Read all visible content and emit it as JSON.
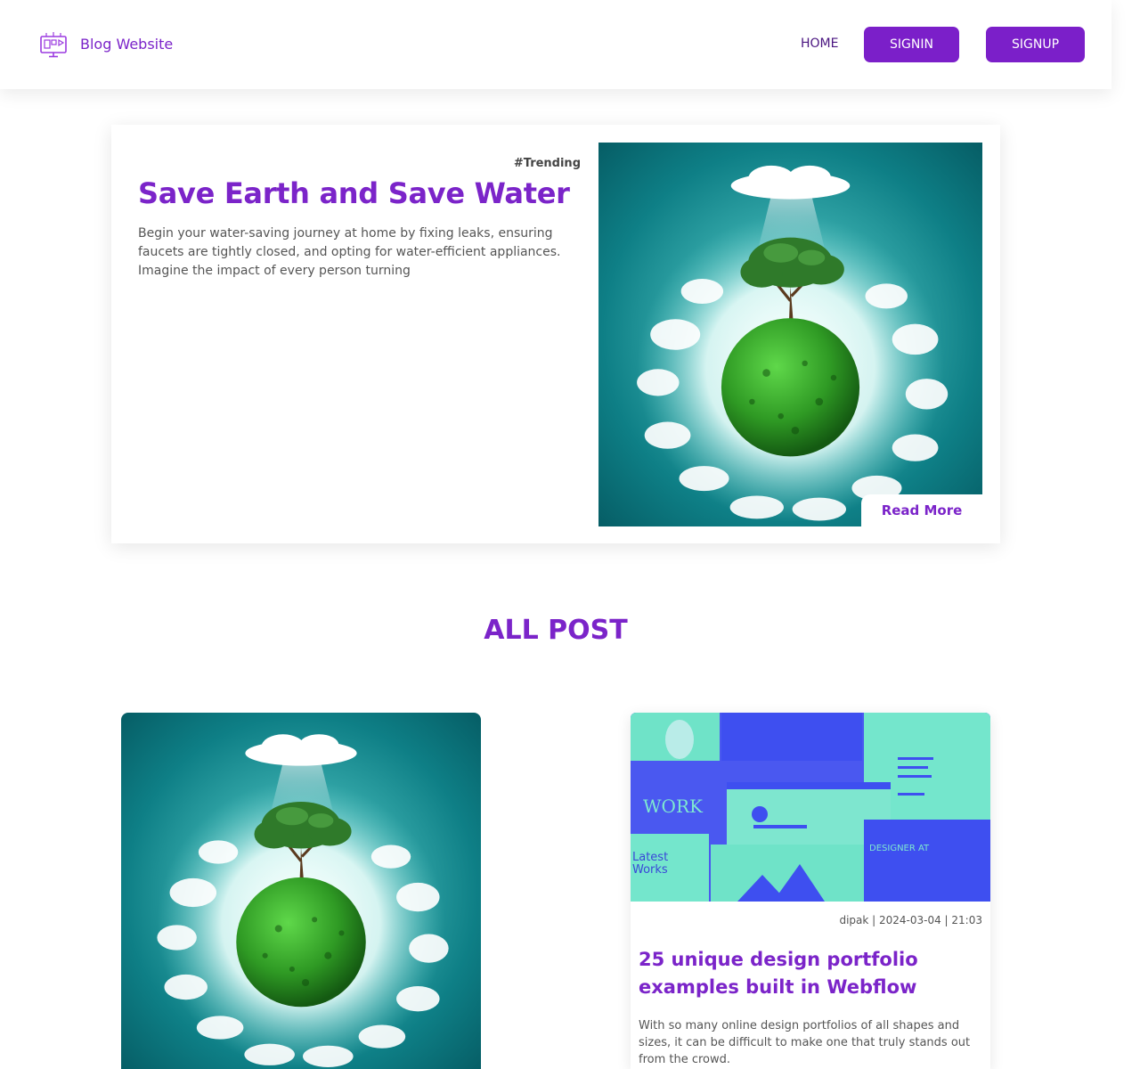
{
  "header": {
    "brand": "Blog Website",
    "nav_home": "HOME",
    "signin": "SIGNIN",
    "signup": "SIGNUP",
    "logo_icon": "monitor-blog-icon"
  },
  "hero": {
    "tag": "#Trending",
    "title": "Save Earth and Save Water",
    "description": "Begin your water-saving journey at home by fixing leaks, ensuring faucets are tightly closed, and opting for water-efficient appliances. Imagine the impact of every person turning",
    "read_more": "Read More",
    "image": "earth-globe-tree-image"
  },
  "section": {
    "title": "ALL POST"
  },
  "posts": [
    {
      "image": "earth-globe-tree-image"
    },
    {
      "image": "portfolio-collage-image",
      "meta": "dipak | 2024-03-04 | 21:03",
      "title": "25 unique design portfolio examples built in Webflow",
      "description": "With so many online design portfolios of all shapes and sizes, it can be difficult to make one that truly stands out from the crowd."
    }
  ],
  "colors": {
    "accent": "#7b24c9",
    "button": "#7b1fc9",
    "teal": "#0e6e75"
  }
}
